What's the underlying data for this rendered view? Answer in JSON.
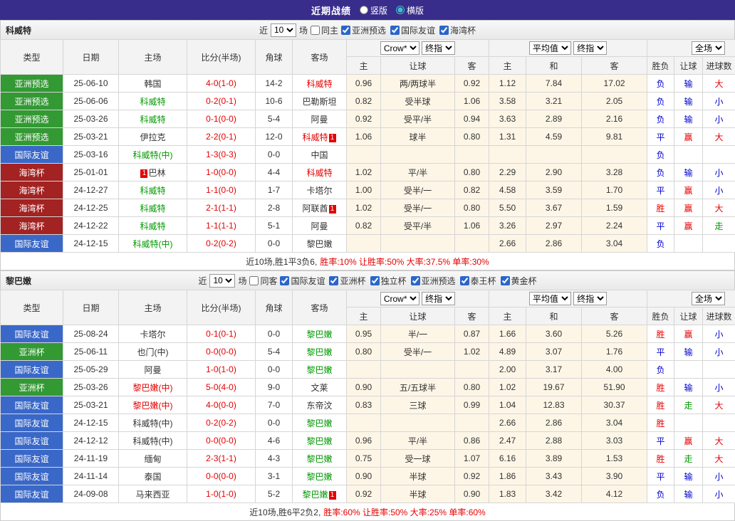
{
  "topbar": {
    "title": "近期战绩",
    "radios": [
      {
        "label": "竖版",
        "checked": false
      },
      {
        "label": "横版",
        "checked": true
      }
    ]
  },
  "table_headers": {
    "type": "类型",
    "date": "日期",
    "home": "主场",
    "score": "比分(半场)",
    "corner": "角球",
    "away": "客场",
    "odds_home": "主",
    "odds_handicap": "让球",
    "odds_away": "客",
    "avg_home": "主",
    "avg_draw": "和",
    "avg_away": "客",
    "result": "胜负",
    "handicap_result": "让球",
    "goals": "进球数"
  },
  "selects": {
    "bookmaker": "Crow*",
    "final_a": "终指",
    "average": "平均值",
    "final_b": "终指",
    "scope": "全场"
  },
  "sections": [
    {
      "team": "科威特",
      "filter": {
        "near": "近",
        "count": "10",
        "games": "场",
        "same": {
          "label": "同主",
          "checked": false
        },
        "leagues": [
          {
            "label": "亚洲预选",
            "checked": true
          },
          {
            "label": "国际友谊",
            "checked": true
          },
          {
            "label": "海湾杯",
            "checked": true
          }
        ]
      },
      "rows": [
        {
          "t": "亚洲预选",
          "tc": "green",
          "d": "25-06-10",
          "h": {
            "n": "韩国",
            "c": "black"
          },
          "s": "4-0(1-0)",
          "cn": "14-2",
          "a": {
            "n": "科威特",
            "c": "red"
          },
          "o1": "0.96",
          "hc": "两/两球半",
          "o2": "0.92",
          "m1": "1.12",
          "m2": "7.84",
          "m3": "17.02",
          "r1": {
            "n": "负",
            "c": "blue"
          },
          "r2": {
            "n": "输",
            "c": "blue"
          },
          "r3": {
            "n": "大",
            "c": "red"
          }
        },
        {
          "t": "亚洲预选",
          "tc": "green",
          "d": "25-06-06",
          "h": {
            "n": "科威特",
            "c": "green"
          },
          "s": "0-2(0-1)",
          "cn": "10-6",
          "a": {
            "n": "巴勒斯坦",
            "c": "black"
          },
          "o1": "0.82",
          "hc": "受半球",
          "o2": "1.06",
          "m1": "3.58",
          "m2": "3.21",
          "m3": "2.05",
          "r1": {
            "n": "负",
            "c": "blue"
          },
          "r2": {
            "n": "输",
            "c": "blue"
          },
          "r3": {
            "n": "小",
            "c": "blue"
          }
        },
        {
          "t": "亚洲预选",
          "tc": "green",
          "d": "25-03-26",
          "h": {
            "n": "科威特",
            "c": "green"
          },
          "s": "0-1(0-0)",
          "cn": "5-4",
          "a": {
            "n": "阿曼",
            "c": "black"
          },
          "o1": "0.92",
          "hc": "受平/半",
          "o2": "0.94",
          "m1": "3.63",
          "m2": "2.89",
          "m3": "2.16",
          "r1": {
            "n": "负",
            "c": "blue"
          },
          "r2": {
            "n": "输",
            "c": "blue"
          },
          "r3": {
            "n": "小",
            "c": "blue"
          }
        },
        {
          "t": "亚洲预选",
          "tc": "green",
          "d": "25-03-21",
          "h": {
            "n": "伊拉克",
            "c": "black"
          },
          "s": "2-2(0-1)",
          "cn": "12-0",
          "a": {
            "n": "科威特",
            "c": "red",
            "b": "1",
            "bp": "r"
          },
          "o1": "1.06",
          "hc": "球半",
          "o2": "0.80",
          "m1": "1.31",
          "m2": "4.59",
          "m3": "9.81",
          "r1": {
            "n": "平",
            "c": "blue"
          },
          "r2": {
            "n": "赢",
            "c": "red"
          },
          "r3": {
            "n": "大",
            "c": "red"
          }
        },
        {
          "t": "国际友谊",
          "tc": "blue",
          "d": "25-03-16",
          "h": {
            "n": "科威特(中)",
            "c": "green"
          },
          "s": "1-3(0-3)",
          "cn": "0-0",
          "a": {
            "n": "中国",
            "c": "black"
          },
          "o1": "",
          "hc": "",
          "o2": "",
          "m1": "",
          "m2": "",
          "m3": "",
          "r1": {
            "n": "负",
            "c": "blue"
          },
          "r2": "",
          "r3": ""
        },
        {
          "t": "海湾杯",
          "tc": "darkred",
          "d": "25-01-01",
          "h": {
            "n": "巴林",
            "c": "black",
            "b": "1",
            "bp": "l"
          },
          "s": "1-0(0-0)",
          "cn": "4-4",
          "a": {
            "n": "科威特",
            "c": "red"
          },
          "o1": "1.02",
          "hc": "平/半",
          "o2": "0.80",
          "m1": "2.29",
          "m2": "2.90",
          "m3": "3.28",
          "r1": {
            "n": "负",
            "c": "blue"
          },
          "r2": {
            "n": "输",
            "c": "blue"
          },
          "r3": {
            "n": "小",
            "c": "blue"
          }
        },
        {
          "t": "海湾杯",
          "tc": "darkred",
          "d": "24-12-27",
          "h": {
            "n": "科威特",
            "c": "green"
          },
          "s": "1-1(0-0)",
          "cn": "1-7",
          "a": {
            "n": "卡塔尔",
            "c": "black"
          },
          "o1": "1.00",
          "hc": "受半/一",
          "o2": "0.82",
          "m1": "4.58",
          "m2": "3.59",
          "m3": "1.70",
          "r1": {
            "n": "平",
            "c": "blue"
          },
          "r2": {
            "n": "赢",
            "c": "red"
          },
          "r3": {
            "n": "小",
            "c": "blue"
          }
        },
        {
          "t": "海湾杯",
          "tc": "darkred",
          "d": "24-12-25",
          "h": {
            "n": "科威特",
            "c": "green"
          },
          "s": "2-1(1-1)",
          "cn": "2-8",
          "a": {
            "n": "阿联酋",
            "c": "black",
            "b": "1",
            "bp": "r"
          },
          "o1": "1.02",
          "hc": "受半/一",
          "o2": "0.80",
          "m1": "5.50",
          "m2": "3.67",
          "m3": "1.59",
          "r1": {
            "n": "胜",
            "c": "red"
          },
          "r2": {
            "n": "赢",
            "c": "red"
          },
          "r3": {
            "n": "大",
            "c": "red"
          }
        },
        {
          "t": "海湾杯",
          "tc": "darkred",
          "d": "24-12-22",
          "h": {
            "n": "科威特",
            "c": "green"
          },
          "s": "1-1(1-1)",
          "cn": "5-1",
          "a": {
            "n": "阿曼",
            "c": "black"
          },
          "o1": "0.82",
          "hc": "受平/半",
          "o2": "1.06",
          "m1": "3.26",
          "m2": "2.97",
          "m3": "2.24",
          "r1": {
            "n": "平",
            "c": "blue"
          },
          "r2": {
            "n": "赢",
            "c": "red"
          },
          "r3": {
            "n": "走",
            "c": "green"
          }
        },
        {
          "t": "国际友谊",
          "tc": "blue",
          "d": "24-12-15",
          "h": {
            "n": "科威特(中)",
            "c": "green"
          },
          "s": "0-2(0-2)",
          "cn": "0-0",
          "a": {
            "n": "黎巴嫩",
            "c": "black"
          },
          "o1": "",
          "hc": "",
          "o2": "",
          "m1": "2.66",
          "m2": "2.86",
          "m3": "3.04",
          "r1": {
            "n": "负",
            "c": "blue"
          },
          "r2": "",
          "r3": ""
        }
      ],
      "summary": {
        "plain": "近10场,胜1平3负6,",
        "red": "胜率:10% 让胜率:50% 大率:37.5% 单率:30%"
      }
    },
    {
      "team": "黎巴嫩",
      "filter": {
        "near": "近",
        "count": "10",
        "games": "场",
        "same": {
          "label": "同客",
          "checked": false
        },
        "leagues": [
          {
            "label": "国际友谊",
            "checked": true
          },
          {
            "label": "亚洲杯",
            "checked": true
          },
          {
            "label": "独立杯",
            "checked": true
          },
          {
            "label": "亚洲预选",
            "checked": true
          },
          {
            "label": "泰王杯",
            "checked": true
          },
          {
            "label": "黄金杯",
            "checked": true
          }
        ]
      },
      "rows": [
        {
          "t": "国际友谊",
          "tc": "blue",
          "d": "25-08-24",
          "h": {
            "n": "卡塔尔",
            "c": "black"
          },
          "s": "0-1(0-1)",
          "cn": "0-0",
          "a": {
            "n": "黎巴嫩",
            "c": "green"
          },
          "o1": "0.95",
          "hc": "半/一",
          "o2": "0.87",
          "m1": "1.66",
          "m2": "3.60",
          "m3": "5.26",
          "r1": {
            "n": "胜",
            "c": "red"
          },
          "r2": {
            "n": "赢",
            "c": "red"
          },
          "r3": {
            "n": "小",
            "c": "blue"
          }
        },
        {
          "t": "亚洲杯",
          "tc": "green",
          "d": "25-06-11",
          "h": {
            "n": "也门(中)",
            "c": "black"
          },
          "s": "0-0(0-0)",
          "cn": "5-4",
          "a": {
            "n": "黎巴嫩",
            "c": "green"
          },
          "o1": "0.80",
          "hc": "受半/一",
          "o2": "1.02",
          "m1": "4.89",
          "m2": "3.07",
          "m3": "1.76",
          "r1": {
            "n": "平",
            "c": "blue"
          },
          "r2": {
            "n": "输",
            "c": "blue"
          },
          "r3": {
            "n": "小",
            "c": "blue"
          }
        },
        {
          "t": "国际友谊",
          "tc": "blue",
          "d": "25-05-29",
          "h": {
            "n": "阿曼",
            "c": "black"
          },
          "s": "1-0(1-0)",
          "cn": "0-0",
          "a": {
            "n": "黎巴嫩",
            "c": "green"
          },
          "o1": "",
          "hc": "",
          "o2": "",
          "m1": "2.00",
          "m2": "3.17",
          "m3": "4.00",
          "r1": {
            "n": "负",
            "c": "blue"
          },
          "r2": "",
          "r3": ""
        },
        {
          "t": "亚洲杯",
          "tc": "green",
          "d": "25-03-26",
          "h": {
            "n": "黎巴嫩(中)",
            "c": "red"
          },
          "s": "5-0(4-0)",
          "cn": "9-0",
          "a": {
            "n": "文莱",
            "c": "black"
          },
          "o1": "0.90",
          "hc": "五/五球半",
          "o2": "0.80",
          "m1": "1.02",
          "m2": "19.67",
          "m3": "51.90",
          "r1": {
            "n": "胜",
            "c": "red"
          },
          "r2": {
            "n": "输",
            "c": "blue"
          },
          "r3": {
            "n": "小",
            "c": "blue"
          }
        },
        {
          "t": "国际友谊",
          "tc": "blue",
          "d": "25-03-21",
          "h": {
            "n": "黎巴嫩(中)",
            "c": "red"
          },
          "s": "4-0(0-0)",
          "cn": "7-0",
          "a": {
            "n": "东帝汶",
            "c": "black"
          },
          "o1": "0.83",
          "hc": "三球",
          "o2": "0.99",
          "m1": "1.04",
          "m2": "12.83",
          "m3": "30.37",
          "r1": {
            "n": "胜",
            "c": "red"
          },
          "r2": {
            "n": "走",
            "c": "green"
          },
          "r3": {
            "n": "大",
            "c": "red"
          }
        },
        {
          "t": "国际友谊",
          "tc": "blue",
          "d": "24-12-15",
          "h": {
            "n": "科威特(中)",
            "c": "black"
          },
          "s": "0-2(0-2)",
          "cn": "0-0",
          "a": {
            "n": "黎巴嫩",
            "c": "green"
          },
          "o1": "",
          "hc": "",
          "o2": "",
          "m1": "2.66",
          "m2": "2.86",
          "m3": "3.04",
          "r1": {
            "n": "胜",
            "c": "red"
          },
          "r2": "",
          "r3": ""
        },
        {
          "t": "国际友谊",
          "tc": "blue",
          "d": "24-12-12",
          "h": {
            "n": "科威特(中)",
            "c": "black"
          },
          "s": "0-0(0-0)",
          "cn": "4-6",
          "a": {
            "n": "黎巴嫩",
            "c": "green"
          },
          "o1": "0.96",
          "hc": "平/半",
          "o2": "0.86",
          "m1": "2.47",
          "m2": "2.88",
          "m3": "3.03",
          "r1": {
            "n": "平",
            "c": "blue"
          },
          "r2": {
            "n": "赢",
            "c": "red"
          },
          "r3": {
            "n": "大",
            "c": "red"
          }
        },
        {
          "t": "国际友谊",
          "tc": "blue",
          "d": "24-11-19",
          "h": {
            "n": "缅甸",
            "c": "black"
          },
          "s": "2-3(1-1)",
          "cn": "4-3",
          "a": {
            "n": "黎巴嫩",
            "c": "green"
          },
          "o1": "0.75",
          "hc": "受一球",
          "o2": "1.07",
          "m1": "6.16",
          "m2": "3.89",
          "m3": "1.53",
          "r1": {
            "n": "胜",
            "c": "red"
          },
          "r2": {
            "n": "走",
            "c": "green"
          },
          "r3": {
            "n": "大",
            "c": "red"
          }
        },
        {
          "t": "国际友谊",
          "tc": "blue",
          "d": "24-11-14",
          "h": {
            "n": "泰国",
            "c": "black"
          },
          "s": "0-0(0-0)",
          "cn": "3-1",
          "a": {
            "n": "黎巴嫩",
            "c": "green"
          },
          "o1": "0.90",
          "hc": "半球",
          "o2": "0.92",
          "m1": "1.86",
          "m2": "3.43",
          "m3": "3.90",
          "r1": {
            "n": "平",
            "c": "blue"
          },
          "r2": {
            "n": "输",
            "c": "blue"
          },
          "r3": {
            "n": "小",
            "c": "blue"
          }
        },
        {
          "t": "国际友谊",
          "tc": "blue",
          "d": "24-09-08",
          "h": {
            "n": "马来西亚",
            "c": "black"
          },
          "s": "1-0(1-0)",
          "cn": "5-2",
          "a": {
            "n": "黎巴嫩",
            "c": "green",
            "b": "1",
            "bp": "r"
          },
          "o1": "0.92",
          "hc": "半球",
          "o2": "0.90",
          "m1": "1.83",
          "m2": "3.42",
          "m3": "4.12",
          "r1": {
            "n": "负",
            "c": "blue"
          },
          "r2": {
            "n": "输",
            "c": "blue"
          },
          "r3": {
            "n": "小",
            "c": "blue"
          }
        }
      ],
      "summary": {
        "plain": "近10场,胜6平2负2,",
        "red": "胜率:60% 让胜率:50% 大率:25% 单率:60%"
      }
    }
  ]
}
